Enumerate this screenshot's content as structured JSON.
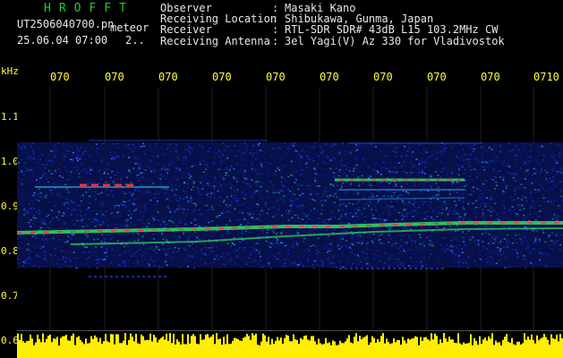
{
  "header": {
    "app_title": "HROFFT",
    "file_name": "UT2506040700.pn",
    "meteor_label": "meteor",
    "date_time": "25.06.04 07:00",
    "count_label": "2.."
  },
  "info": [
    {
      "key": "Observer",
      "sep": ":",
      "value": "Masaki Kano"
    },
    {
      "key": "Receiving Location",
      "sep": ":",
      "value": "Shibukawa, Gunma, Japan"
    },
    {
      "key": "Receiver",
      "sep": ":",
      "value": "RTL-SDR SDR# 43dB L15 103.2MHz CW"
    },
    {
      "key": "Receiving Antenna",
      "sep": ":",
      "value": "3el Yagi(V) Az 330 for Vladivostok"
    }
  ],
  "axis": {
    "unit": "kHz",
    "y_ticks": [
      "1.1",
      "1.0",
      "0.9",
      "0.8",
      "0.7",
      "0.6"
    ],
    "time_ticks": [
      "070",
      "070",
      "070",
      "070",
      "070",
      "070",
      "070",
      "070",
      "070",
      "0710"
    ]
  },
  "colors": {
    "title_green": "#22cc22",
    "axis_yellow": "#ffff33",
    "signal_yellow": "#ffee00",
    "noise_blue": "#1030c0",
    "trace_green": "#30e060",
    "trace_red": "#ff3030"
  }
}
